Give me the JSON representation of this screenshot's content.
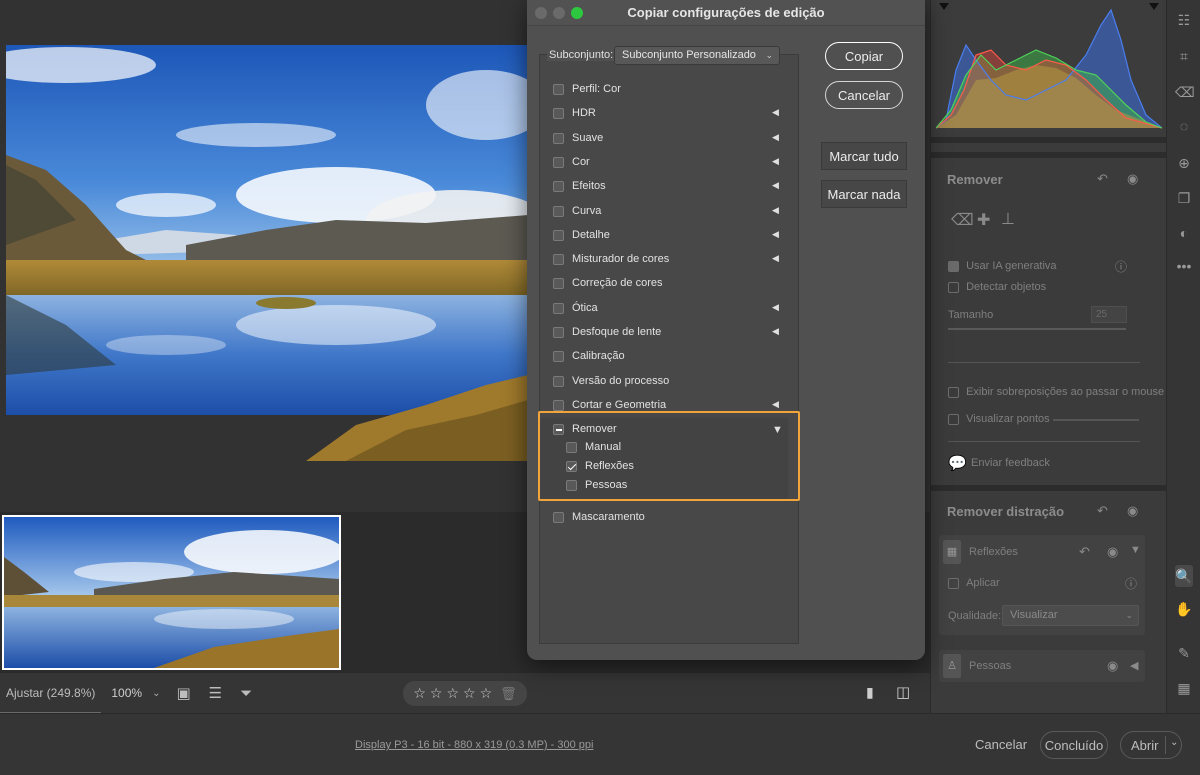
{
  "dialog": {
    "title": "Copiar configurações de edição",
    "subset_label": "Subconjunto:",
    "subset_value": "Subconjunto Personalizado",
    "buttons": {
      "copy": "Copiar",
      "cancel": "Cancelar",
      "check_all": "Marcar tudo",
      "check_none": "Marcar nada"
    },
    "options": [
      {
        "label": "Perfil: Cor",
        "checked": false,
        "arrow": false
      },
      {
        "label": "HDR",
        "checked": false,
        "arrow": true
      },
      {
        "label": "Suave",
        "checked": false,
        "arrow": true
      },
      {
        "label": "Cor",
        "checked": false,
        "arrow": true
      },
      {
        "label": "Efeitos",
        "checked": false,
        "arrow": true
      },
      {
        "label": "Curva",
        "checked": false,
        "arrow": true
      },
      {
        "label": "Detalhe",
        "checked": false,
        "arrow": true
      },
      {
        "label": "Misturador de cores",
        "checked": false,
        "arrow": true
      },
      {
        "label": "Correção de cores",
        "checked": false,
        "arrow": false
      },
      {
        "label": "Ótica",
        "checked": false,
        "arrow": true
      },
      {
        "label": "Desfoque de lente",
        "checked": false,
        "arrow": true
      },
      {
        "label": "Calibração",
        "checked": false,
        "arrow": false
      },
      {
        "label": "Versão do processo",
        "checked": false,
        "arrow": false
      },
      {
        "label": "Cortar e Geometria",
        "checked": false,
        "arrow": true
      }
    ],
    "remover": {
      "label": "Remover",
      "state": "mixed",
      "children": [
        {
          "label": "Manual",
          "checked": false
        },
        {
          "label": "Reflexões",
          "checked": true
        },
        {
          "label": "Pessoas",
          "checked": false
        }
      ]
    },
    "masking": {
      "label": "Mascaramento",
      "checked": false
    }
  },
  "toolbar": {
    "zoom_fit": "Ajustar (249.8%)",
    "zoom_level": "100%"
  },
  "footer": {
    "info": "Display P3 - 16 bit - 880 x 319 (0.3 MP) - 300 ppi",
    "cancel": "Cancelar",
    "done": "Concluído",
    "open": "Abrir"
  },
  "right_panel": {
    "remove_title": "Remover",
    "use_gen_ai": "Usar IA generativa",
    "detect_objects": "Detectar objetos",
    "size_label": "Tamanho",
    "size_value": "25",
    "show_overlays": "Exibir sobreposições ao passar o mouse",
    "view_points": "Visualizar pontos",
    "send_feedback": "Enviar feedback",
    "distraction_title": "Remover distração",
    "reflections": "Reflexões",
    "apply": "Aplicar",
    "quality_label": "Qualidade:",
    "quality_value": "Visualizar",
    "people": "Pessoas"
  },
  "colors": {
    "highlight": "#f0a43a",
    "red": "#e0443a",
    "green": "#3cb648",
    "blue": "#3d6ee0"
  }
}
